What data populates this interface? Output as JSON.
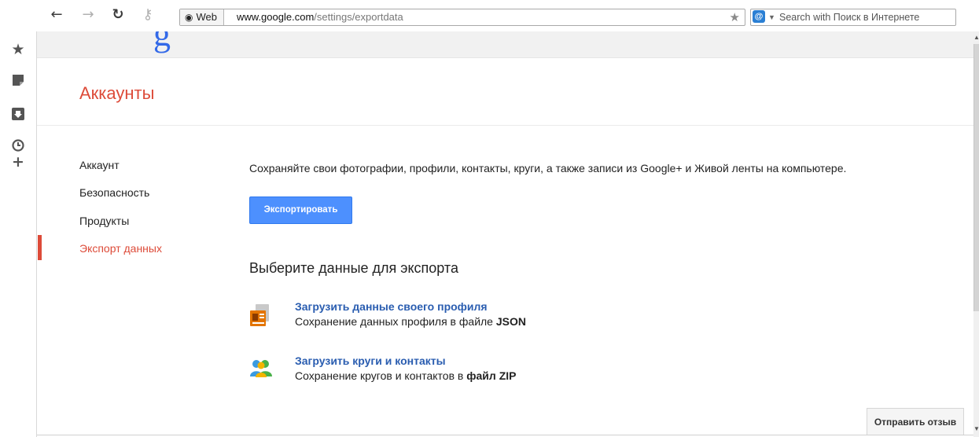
{
  "browser": {
    "back_glyph": "←",
    "forward_glyph": "→",
    "reload_glyph": "↻",
    "key_glyph": "⚷",
    "url_chip_label": "Web",
    "url_host": "www.google.com",
    "url_path": "/settings/exportdata",
    "bookmark_star": "★",
    "search_engine_glyph": "@",
    "search_dropdown_glyph": "▼",
    "search_placeholder": "Search with Поиск в Интернете"
  },
  "browser_sidebar": {
    "items": [
      {
        "name": "bookmarks-star-icon",
        "glyph": "★"
      },
      {
        "name": "notes-icon",
        "glyph": "▪"
      },
      {
        "name": "downloads-icon",
        "glyph": "⬇"
      },
      {
        "name": "history-clock-icon",
        "glyph": "◷"
      },
      {
        "name": "add-panel-icon",
        "glyph": "+"
      }
    ]
  },
  "page": {
    "logo_fragment": "g",
    "title": "Аккаунты",
    "nav": [
      {
        "label": "Аккаунт",
        "active": false
      },
      {
        "label": "Безопасность",
        "active": false
      },
      {
        "label": "Продукты",
        "active": false
      },
      {
        "label": "Экспорт данных",
        "active": true
      }
    ],
    "intro": "Сохраняйте свои фотографии, профили, контакты, круги, а также записи из Google+ и Живой ленты на компьютере.",
    "export_button": "Экспортировать",
    "section_heading": "Выберите данные для экспорта",
    "items": [
      {
        "link": "Загрузить данные своего профиля",
        "desc_prefix": "Сохранение данных профиля в файле ",
        "desc_bold": "JSON"
      },
      {
        "link": "Загрузить круги и контакты",
        "desc_prefix": "Сохранение кругов и контактов в ",
        "desc_bold": "файл ZIP"
      }
    ],
    "feedback_button": "Отправить отзыв"
  },
  "colors": {
    "accent_red": "#dd4b39",
    "button_blue": "#4d90fe",
    "link_blue": "#2a5db0"
  }
}
